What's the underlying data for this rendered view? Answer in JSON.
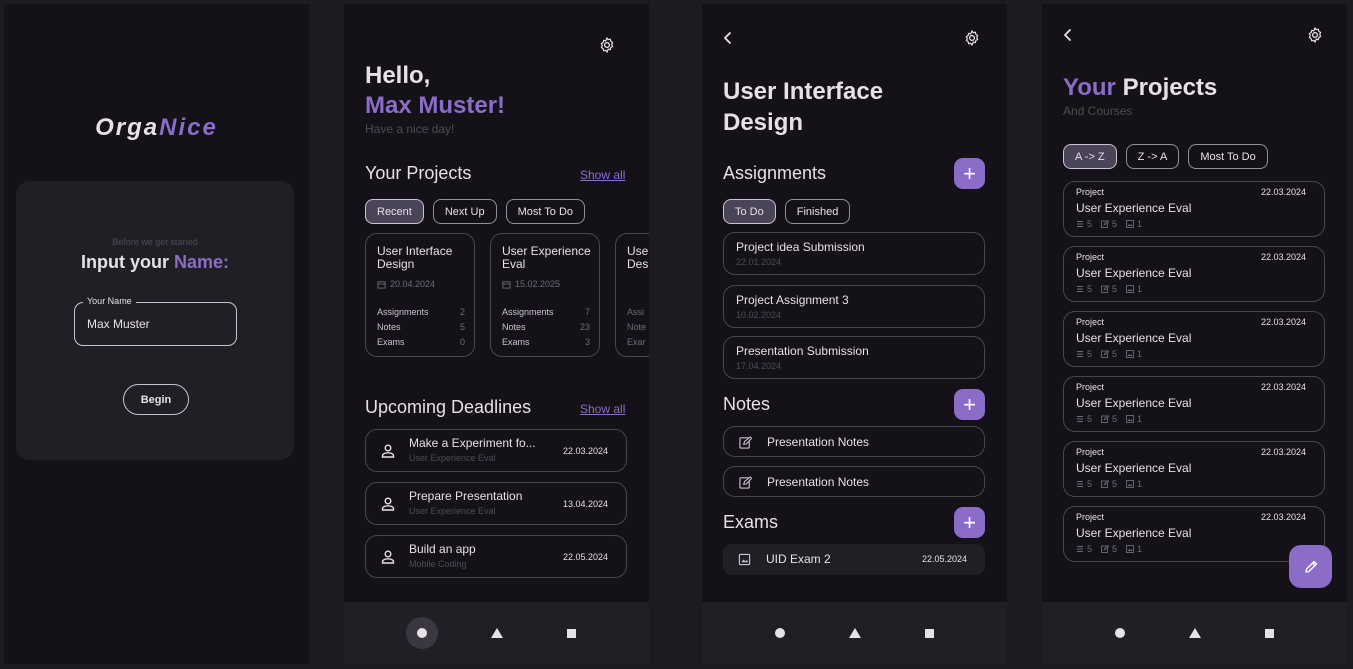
{
  "screen1": {
    "logo_part1": "Orga",
    "logo_part2": "Nice",
    "pre_title": "Before we get started",
    "title_part1": "Input your",
    "title_part2": "Name:",
    "field_label": "Your Name",
    "field_value": "Max Muster",
    "begin_label": "Begin"
  },
  "screen2": {
    "hello": "Hello,",
    "name": "Max Muster!",
    "subtitle": "Have a nice day!",
    "projects_heading": "Your Projects",
    "show_all": "Show all",
    "chips": [
      "Recent",
      "Next Up",
      "Most To Do"
    ],
    "selected_chip": "Recent",
    "projects": [
      {
        "title": "User Interface Design",
        "date": "20.04.2024",
        "assignments_label": "Assignments",
        "assignments": "2",
        "notes_label": "Notes",
        "notes": "5",
        "exams_label": "Exams",
        "exams": "0"
      },
      {
        "title": "User Experience Eval",
        "date": "15.02.2025",
        "assignments_label": "Assignments",
        "assignments": "7",
        "notes_label": "Notes",
        "notes": "23",
        "exams_label": "Exams",
        "exams": "3"
      },
      {
        "title": "User Interface Design",
        "date": "",
        "assignments_label": "Assi",
        "assignments": "",
        "notes_label": "Note",
        "notes": "",
        "exams_label": "Exar",
        "exams": ""
      }
    ],
    "deadlines_heading": "Upcoming Deadlines",
    "deadlines_show_all": "Show all",
    "deadlines": [
      {
        "title": "Make a Experiment fo...",
        "subtitle": "User Experience Eval",
        "date": "22.03.2024"
      },
      {
        "title": "Prepare Presentation",
        "subtitle": "User Experience Eval",
        "date": "13.04.2024"
      },
      {
        "title": "Build an app",
        "subtitle": "Mobile Coding",
        "date": "22.05.2024"
      }
    ]
  },
  "screen3": {
    "title_line1": "User Interface",
    "title_line2": "Design",
    "assignments_heading": "Assignments",
    "chips": [
      "To Do",
      "Finished"
    ],
    "selected_chip": "To Do",
    "assignments": [
      {
        "title": "Project idea Submission",
        "date": "22.01.2024"
      },
      {
        "title": "Project Assignment 3",
        "date": "10.02.2024"
      },
      {
        "title": "Presentation Submission",
        "date": "17.04.2024"
      }
    ],
    "notes_heading": "Notes",
    "notes": [
      {
        "title": "Presentation Notes"
      },
      {
        "title": "Presentation Notes"
      }
    ],
    "exams_heading": "Exams",
    "exams": [
      {
        "title": "UID Exam 2",
        "date": "22.05.2024"
      }
    ]
  },
  "screen4": {
    "title_part1": "Your",
    "title_part2": "Projects",
    "subtitle": "And Courses",
    "chips": [
      "A -> Z",
      "Z -> A",
      "Most To Do"
    ],
    "selected_chip": "A -> Z",
    "projects": [
      {
        "label": "Project",
        "title": "User Experience Eval",
        "date": "22.03.2024",
        "assignments": "5",
        "notes": "5",
        "exams": "1"
      },
      {
        "label": "Project",
        "title": "User Experience Eval",
        "date": "22.03.2024",
        "assignments": "5",
        "notes": "5",
        "exams": "1"
      },
      {
        "label": "Project",
        "title": "User Experience Eval",
        "date": "22.03.2024",
        "assignments": "5",
        "notes": "5",
        "exams": "1"
      },
      {
        "label": "Project",
        "title": "User Experience Eval",
        "date": "22.03.2024",
        "assignments": "5",
        "notes": "5",
        "exams": "1"
      },
      {
        "label": "Project",
        "title": "User Experience Eval",
        "date": "22.03.2024",
        "assignments": "5",
        "notes": "5",
        "exams": "1"
      },
      {
        "label": "Project",
        "title": "User Experience Eval",
        "date": "22.03.2024",
        "assignments": "5",
        "notes": "5",
        "exams": "1"
      }
    ]
  },
  "icons": {
    "settings": "gear-icon",
    "back": "chevron-left-icon",
    "person": "person-icon",
    "calendar": "calendar-icon",
    "note": "edit-note-icon",
    "exam": "image-icon",
    "add": "plus-icon",
    "edit": "pencil-icon",
    "nav_home": "circle-icon",
    "nav_back": "triangle-icon",
    "nav_recent": "square-icon"
  },
  "colors": {
    "accent": "#8b6cc8",
    "background": "#141218",
    "card_outline": "#49454f",
    "nav_bar": "#211f26"
  }
}
